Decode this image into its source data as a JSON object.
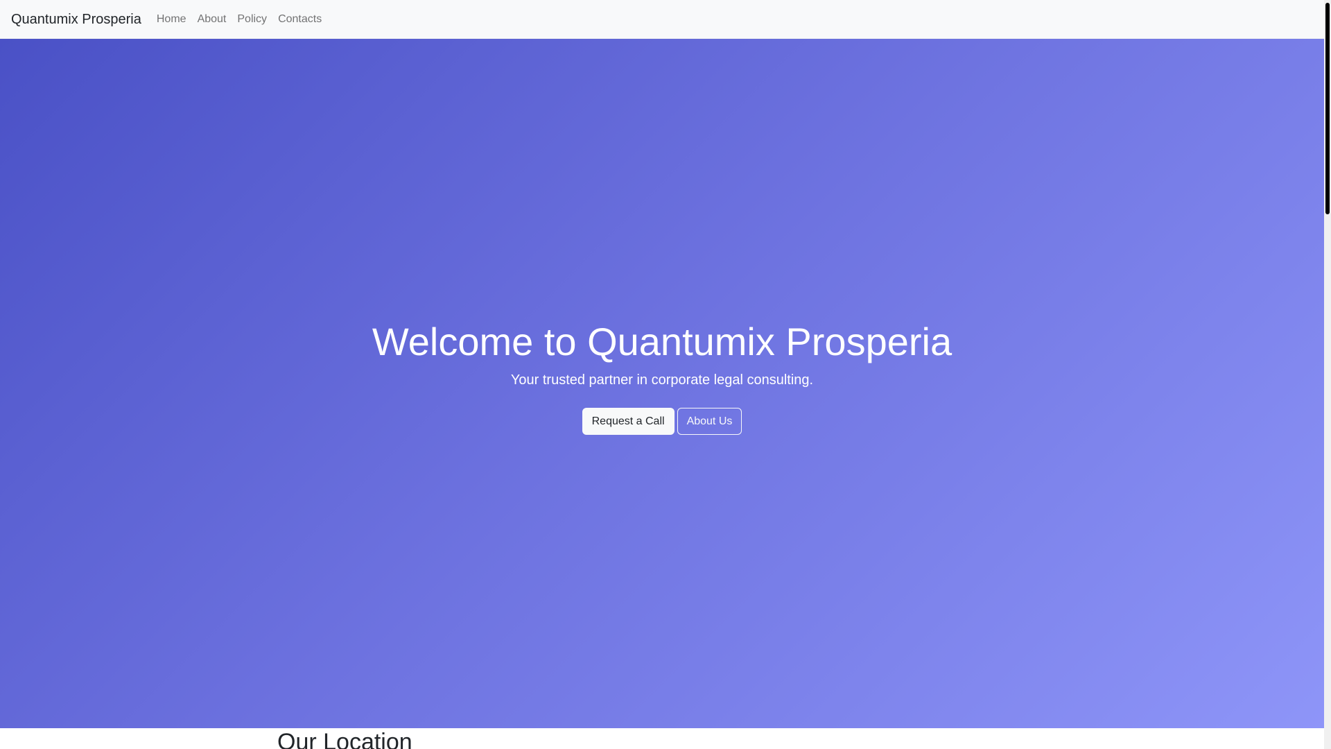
{
  "navbar": {
    "brand": "Quantumix Prosperia",
    "links": [
      {
        "label": "Home"
      },
      {
        "label": "About"
      },
      {
        "label": "Policy"
      },
      {
        "label": "Contacts"
      }
    ]
  },
  "hero": {
    "title": "Welcome to Quantumix Prosperia",
    "subtitle": "Your trusted partner in corporate legal consulting.",
    "primary_button": "Request a Call",
    "secondary_button": "About Us",
    "gradient_start": "#4a51c6",
    "gradient_end": "#8e95f8"
  },
  "location": {
    "title": "Our Location"
  },
  "scrollbar": {
    "position": 0
  }
}
